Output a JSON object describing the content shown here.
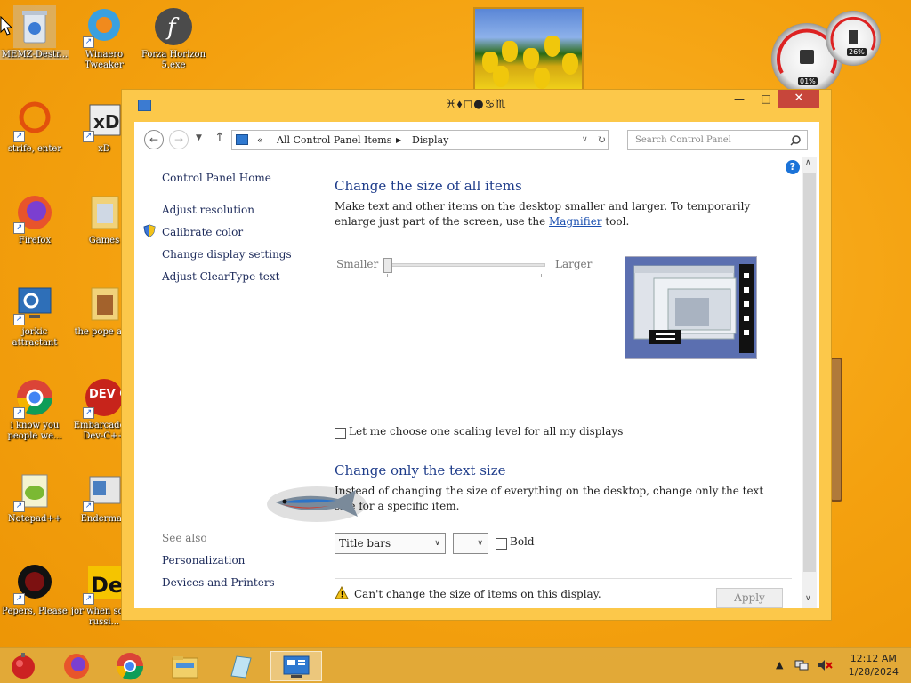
{
  "desktop": {
    "icons": [
      {
        "label": "MEMZ-Destr..."
      },
      {
        "label": "Winaero Tweaker"
      },
      {
        "label": "Forza Horizon 5.exe"
      },
      {
        "label": "strife, enter"
      },
      {
        "label": "xD"
      },
      {
        "label": "Firefox"
      },
      {
        "label": "Games"
      },
      {
        "label": "jorkic attractant"
      },
      {
        "label": "the pope abit"
      },
      {
        "label": "i know you people we..."
      },
      {
        "label": "Embarcadero Dev-C++"
      },
      {
        "label": "Notepad++"
      },
      {
        "label": "Enderman"
      },
      {
        "label": "Pepers, Please"
      },
      {
        "label": "jor when some russi..."
      }
    ],
    "gauges": {
      "cpu": "01%",
      "ram": "26%"
    },
    "dev_badge": "DEV C++",
    "de_badge": "De"
  },
  "window": {
    "title": "♓︎⬧︎◻︎●︎♋︎♏︎ ",
    "address": {
      "prefix": "«",
      "crumb1": "All Control Panel Items",
      "crumb2": "Display"
    },
    "search_placeholder": "Search Control Panel",
    "left": {
      "home": "Control Panel Home",
      "adjust_resolution": "Adjust resolution",
      "calibrate_color": "Calibrate color",
      "change_display": "Change display settings",
      "cleartype": "Adjust ClearType text",
      "see_also": "See also",
      "personalization": "Personalization",
      "devices": "Devices and Printers"
    },
    "main": {
      "heading1": "Change the size of all items",
      "desc1_a": "Make text and other items on the desktop smaller and larger. To temporarily enlarge just part of the screen, use the ",
      "desc1_link": "Magnifier",
      "desc1_b": " tool.",
      "slider": {
        "smaller": "Smaller",
        "larger": "Larger",
        "level": 0
      },
      "checkbox_label": "Let me choose one scaling level for all my displays",
      "checkbox_checked": false,
      "heading2": "Change only the text size",
      "desc2": "Instead of changing the size of everything on the desktop, change only the text size for a specific item.",
      "item_select": "Title bars",
      "size_select": "",
      "bold_label": "Bold",
      "bold_checked": false,
      "warning": "Can't change the size of items on this display.",
      "apply": "Apply"
    }
  },
  "taskbar": {
    "time": "12:12 AM",
    "date": "1/28/2024"
  }
}
